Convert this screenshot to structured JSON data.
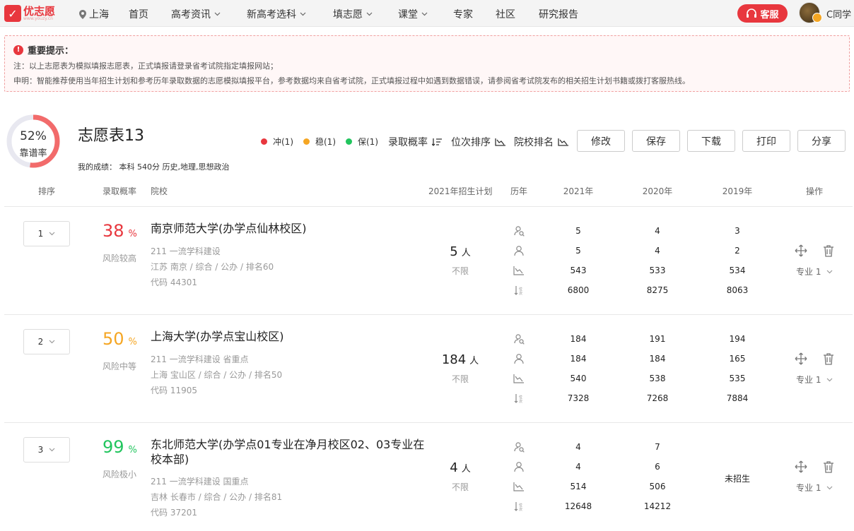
{
  "nav": {
    "logo_text": "优志愿",
    "logo_sub": "www.youzy.cn",
    "location": "上海",
    "items": [
      "首页",
      "高考资讯",
      "新高考选科",
      "填志愿",
      "课堂",
      "专家",
      "社区",
      "研究报告"
    ],
    "kefu_label": "客服",
    "user_name": "C同学"
  },
  "notice": {
    "title": "重要提示：",
    "line1": "注：以上志愿表为模拟填报志愿表，正式填报请登录省考试院指定填报网站；",
    "line2": "申明：智能推荐使用当年招生计划和参考历年录取数据的志愿模拟填报平台，参考数据均来自省考试院，正式填报过程中如遇到数据错误，请参阅省考试院发布的相关招生计划书籍或拨打客服热线。"
  },
  "summary": {
    "reliability_pct": "52%",
    "reliability_value": 0.52,
    "reliability_label": "靠谱率",
    "title": "志愿表13",
    "score_line": "我的成绩：  本科  540分  历史,地理,思想政治",
    "legend": [
      {
        "label": "冲(1)",
        "color": "#e8373e"
      },
      {
        "label": "稳(1)",
        "color": "#f5a623"
      },
      {
        "label": "保(1)",
        "color": "#22c55e"
      }
    ],
    "sort": {
      "prob": "录取概率",
      "rank": "位次排序",
      "school": "院校排名"
    },
    "buttons": {
      "edit": "修改",
      "save": "保存",
      "download": "下载",
      "print": "打印",
      "share": "分享"
    }
  },
  "table": {
    "headers": {
      "rank": "排序",
      "prob": "录取概率",
      "school": "院校",
      "plan": "2021年招生计划",
      "history": "历年",
      "y2021": "2021年",
      "y2020": "2020年",
      "y2019": "2019年",
      "ops": "操作"
    },
    "rows": [
      {
        "rank": "1",
        "prob": "38",
        "pct": "%",
        "prob_color": "#e8373e",
        "risk": "风险较高",
        "name": "南京师范大学(办学点仙林校区)",
        "tags": "211 一流学科建设",
        "location": "江苏 南京 / 综合 / 公办 / 排名60",
        "code": "代码 44301",
        "plan_num": "5",
        "plan_unit": "人",
        "plan_sub": "不限",
        "y2021": [
          "5",
          "5",
          "543",
          "6800"
        ],
        "y2020": [
          "4",
          "4",
          "533",
          "8275"
        ],
        "y2019": [
          "3",
          "2",
          "534",
          "8063"
        ],
        "y2019_note": "",
        "major": "专业 1"
      },
      {
        "rank": "2",
        "prob": "50",
        "pct": "%",
        "prob_color": "#f5a623",
        "risk": "风险中等",
        "name": "上海大学(办学点宝山校区)",
        "tags": "211 一流学科建设 省重点",
        "location": "上海 宝山区 / 综合 / 公办 / 排名50",
        "code": "代码 11905",
        "plan_num": "184",
        "plan_unit": "人",
        "plan_sub": "不限",
        "y2021": [
          "184",
          "184",
          "540",
          "7328"
        ],
        "y2020": [
          "191",
          "184",
          "538",
          "7268"
        ],
        "y2019": [
          "194",
          "165",
          "535",
          "7884"
        ],
        "y2019_note": "",
        "major": "专业 1"
      },
      {
        "rank": "3",
        "prob": "99",
        "pct": "%",
        "prob_color": "#22c55e",
        "risk": "风险极小",
        "name": "东北师范大学(办学点01专业在净月校区02、03专业在校本部)",
        "tags": "211 一流学科建设 国重点",
        "location": "吉林 长春市 / 综合 / 公办 / 排名81",
        "code": "代码 37201",
        "plan_num": "4",
        "plan_unit": "人",
        "plan_sub": "不限",
        "y2021": [
          "4",
          "4",
          "514",
          "12648"
        ],
        "y2020": [
          "7",
          "6",
          "506",
          "14212"
        ],
        "y2019": [],
        "y2019_note": "未招生",
        "major": "专业 1"
      }
    ]
  }
}
